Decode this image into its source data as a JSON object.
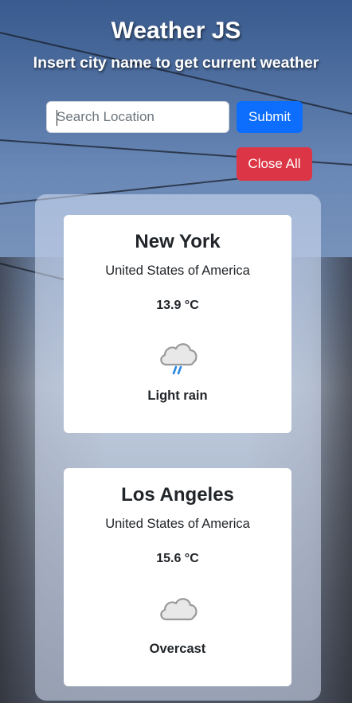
{
  "header": {
    "title": "Weather JS",
    "subtitle": "Insert city name to get current weather"
  },
  "search": {
    "placeholder": "Search Location",
    "value": ""
  },
  "buttons": {
    "submit_label": "Submit",
    "close_all_label": "Close All"
  },
  "colors": {
    "submit": "#0d6efd",
    "close_all": "#dc3545"
  },
  "cards": [
    {
      "city": "New York",
      "country": "United States of America",
      "temperature": "13.9 °C",
      "condition": "Light rain",
      "icon": "light-rain-icon"
    },
    {
      "city": "Los Angeles",
      "country": "United States of America",
      "temperature": "15.6 °C",
      "condition": "Overcast",
      "icon": "overcast-icon"
    }
  ]
}
